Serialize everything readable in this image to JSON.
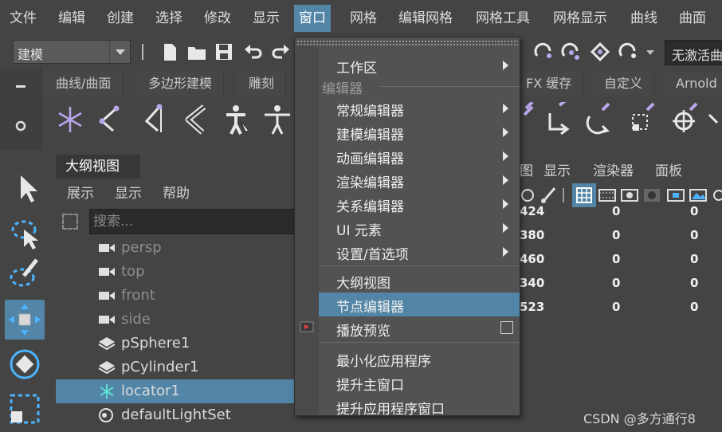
{
  "menubar": {
    "items": [
      "文件",
      "编辑",
      "创建",
      "选择",
      "修改",
      "显示",
      "窗口",
      "网格",
      "编辑网格",
      "网格工具",
      "网格显示",
      "曲线",
      "曲面"
    ],
    "active_index": 6
  },
  "toolbar": {
    "mode_select": "建模",
    "right_field": "无激活曲"
  },
  "shelf": {
    "tabs": [
      "曲线/曲面",
      "多边形建模",
      "雕刻",
      "FX 缓存",
      "自定义",
      "Arnold"
    ]
  },
  "outliner": {
    "tab_label": "大纲视图",
    "menus": [
      "展示",
      "显示",
      "帮助"
    ],
    "search_placeholder": "搜索...",
    "rows": [
      {
        "label": "persp",
        "icon": "camera-icon",
        "dim": true
      },
      {
        "label": "top",
        "icon": "camera-icon",
        "dim": true
      },
      {
        "label": "front",
        "icon": "camera-icon",
        "dim": true
      },
      {
        "label": "side",
        "icon": "camera-icon",
        "dim": true
      },
      {
        "label": "pSphere1",
        "icon": "mesh-icon",
        "dim": false
      },
      {
        "label": "pCylinder1",
        "icon": "mesh-icon",
        "dim": false
      },
      {
        "label": "locator1",
        "icon": "locator-icon",
        "dim": false,
        "selected": true
      },
      {
        "label": "defaultLightSet",
        "icon": "set-icon",
        "dim": false
      }
    ]
  },
  "window_menu": {
    "items": [
      {
        "type": "item",
        "label": "工作区",
        "submenu": true
      },
      {
        "type": "section",
        "label": "编辑器"
      },
      {
        "type": "item",
        "label": "常规编辑器",
        "submenu": true
      },
      {
        "type": "item",
        "label": "建模编辑器",
        "submenu": true
      },
      {
        "type": "item",
        "label": "动画编辑器",
        "submenu": true
      },
      {
        "type": "item",
        "label": "渲染编辑器",
        "submenu": true
      },
      {
        "type": "item",
        "label": "关系编辑器",
        "submenu": true
      },
      {
        "type": "item",
        "label": "UI 元素",
        "submenu": true
      },
      {
        "type": "item",
        "label": "设置/首选项",
        "submenu": true
      },
      {
        "type": "item",
        "label": "大纲视图"
      },
      {
        "type": "item",
        "label": "节点编辑器",
        "highlight": true
      },
      {
        "type": "item",
        "label": "播放预览",
        "checkbox": true
      },
      {
        "type": "item",
        "label": "最小化应用程序"
      },
      {
        "type": "item",
        "label": "提升主窗口"
      },
      {
        "type": "item",
        "label": "提升应用程序窗口"
      }
    ]
  },
  "right_panel": {
    "menus": [
      "图",
      "显示",
      "渲染器",
      "面板"
    ],
    "rows": [
      [
        "424",
        "0",
        "0"
      ],
      [
        "380",
        "0",
        "0"
      ],
      [
        "460",
        "0",
        "0"
      ],
      [
        "340",
        "0",
        "0"
      ],
      [
        "523",
        "0",
        "0"
      ]
    ]
  },
  "watermark": "CSDN @多方通行8",
  "colors": {
    "background": "#444444",
    "highlight": "#5285a6",
    "menu_bg": "#525252",
    "icon_purple": "#b9a6ec"
  }
}
